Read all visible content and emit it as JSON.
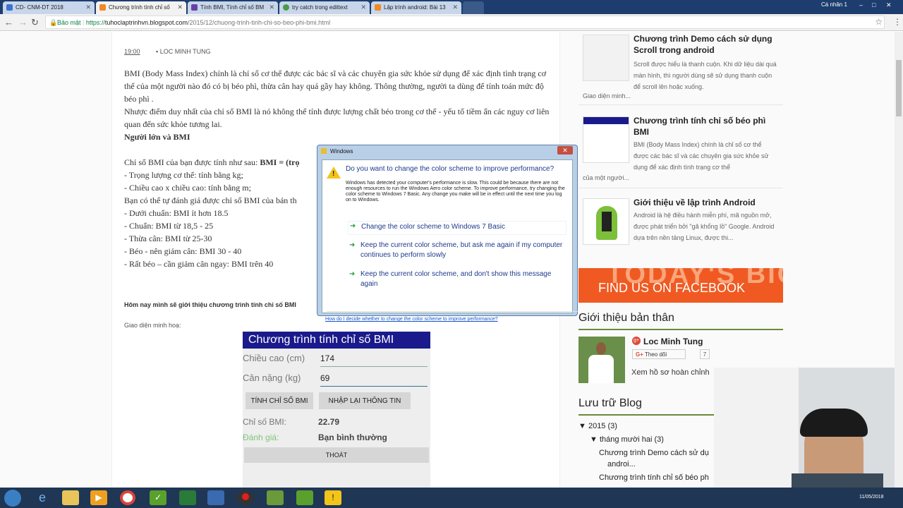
{
  "browser": {
    "tabs": [
      {
        "title": "CD- CNM-DT 2018",
        "icon_color": "#3b73d1"
      },
      {
        "title": "Chương trình tính chỉ số",
        "icon_color": "#f08a24"
      },
      {
        "title": "Tính BMI, Tính chỉ số BM",
        "icon_color": "#6a3ea8"
      },
      {
        "title": "try catch trong edittext",
        "icon_color": "#4a9a4a"
      },
      {
        "title": "Lập trình android: Bài 13",
        "icon_color": "#f08a24"
      }
    ],
    "profile_chip": "Cá nhân 1",
    "secure_label": "Bảo mật",
    "url_scheme": "https://",
    "url_host": "tuhoclaptrinhvn.blogspot.com",
    "url_path": "/2015/12/chuong-trinh-tinh-chi-so-beo-phi-bmi.html"
  },
  "post": {
    "time": "19:00",
    "author": "LOC MINH TUNG",
    "para1": "BMI (Body Mass Index) chính là chỉ số cơ thể được các bác sĩ và các chuyên gia sức khỏe sử dụng để xác định tình trạng cơ thể của một người nào đó có bị béo phì, thừa cân hay quá gầy hay không. Thông thường, người ta dùng để tính toán mức độ béo phì .",
    "para2": "Nhược điểm duy nhất của chỉ số BMI là nó không thể tính được lượng chất béo trong cơ thể - yếu tố tiềm ẩn các nguy cơ liên quan đến sức khỏe tương lai.",
    "heading": "Người lớn và BMI",
    "formula_lead": "Chỉ số BMI của bạn được tính như sau: ",
    "formula_bold": "BMI = (trọ",
    "lines": [
      "- Trọng lượng cơ thể: tính bằng kg;",
      "- Chiều cao x chiều cao: tính bằng m;",
      "Bạn có thể tự đánh giá được chỉ số BMI của bản th",
      "- Dưới chuẩn: BMI ít hơn 18.5",
      "- Chuẩn: BMI từ 18,5 - 25",
      "- Thừa cân: BMI từ 25-30",
      "- Béo - nên giảm cân: BMI 30 - 40",
      "- Rất béo – cần giảm cân ngay: BMI trên 40"
    ],
    "intro": "Hôm nay mình sẽ giới thiệu chương trình tính chỉ số BMI",
    "ui_caption": "Giao diện minh hoạ:"
  },
  "app": {
    "title": "Chương trình tính chỉ số BMI",
    "height_label": "Chiều cao (cm)",
    "height_value": "174",
    "weight_label": "Cân nặng (kg)",
    "weight_value": "69",
    "calc_button": "TÍNH CHỈ SỐ BMI",
    "reset_button": "NHẬP LẠI THÔNG TIN",
    "bmi_label": "Chỉ số BMI:",
    "bmi_value": "22.79",
    "rating_label": "Đánh giá:",
    "rating_value": "Bạn bình thường",
    "exit_button": "THOÁT"
  },
  "sidebar": {
    "posts": [
      {
        "title": "Chương trình Demo cách sử dụng Scroll trong android",
        "snippet": "Scroll được hiểu là thanh cuộn. Khi dữ liệu dài quá màn hình, thì người dùng sẽ sử dụng thanh cuộn để scroll lên hoặc xuống.",
        "tail": "Giao diện minh..."
      },
      {
        "title": "Chương trình tính chỉ số béo phì BMI",
        "snippet": "BMI (Body Mass Index) chính là chỉ số cơ thể được các bác sĩ và các chuyên gia sức khỏe sử dụng để xác định tình trạng cơ thể",
        "tail": "của một người..."
      },
      {
        "title": "Giới thiệu về lập trình Android",
        "snippet": "Android là hệ điều hành miễn phí, mã nguồn mở, được phát triển bởi \"gã khổng lồ\" Google. Android dựa trên nền tảng Linux, được thi...",
        "tail": ""
      }
    ],
    "banner_big": "TODAY'S BIG WINNER!",
    "banner_fb": "FIND US ON FACEBOOK",
    "about_title": "Giới thiệu bản thân",
    "profile_name": "Loc Minh Tung",
    "follow_label": "Theo dõi",
    "follow_count": "7",
    "view_profile": "Xem hồ sơ hoàn chỉnh",
    "archive_title": "Lưu trữ Blog",
    "archive_year": "2015 (3)",
    "archive_month": "tháng mười hai (3)",
    "archive_items": [
      "Chương trình Demo cách sử dụ",
      "androi...",
      "Chương trình tính chỉ số béo ph"
    ]
  },
  "dialog": {
    "window_title": "Windows",
    "heading": "Do you want to change the color scheme to improve performance?",
    "description": "Windows has detected your computer's performance is slow. This could be because there are not enough resources to run the Windows Aero color scheme. To improve performance, try changing the color scheme to Windows 7 Basic. Any change you make will be in effect until the next time you log on to Windows.",
    "options": [
      "Change the color scheme to Windows 7 Basic",
      "Keep the current color scheme, but ask me again if my computer continues to perform slowly",
      "Keep the current color scheme, and don't show this message again"
    ],
    "help_link": "How do I decide whether to change the color scheme to improve performance?"
  },
  "taskbar": {
    "clock": "11/05/2018"
  },
  "colors": {
    "app_header": "#1a1a8c",
    "banner": "#f05a22",
    "widget_rule": "#6a8a3a",
    "taskbar": "#1f3654"
  }
}
